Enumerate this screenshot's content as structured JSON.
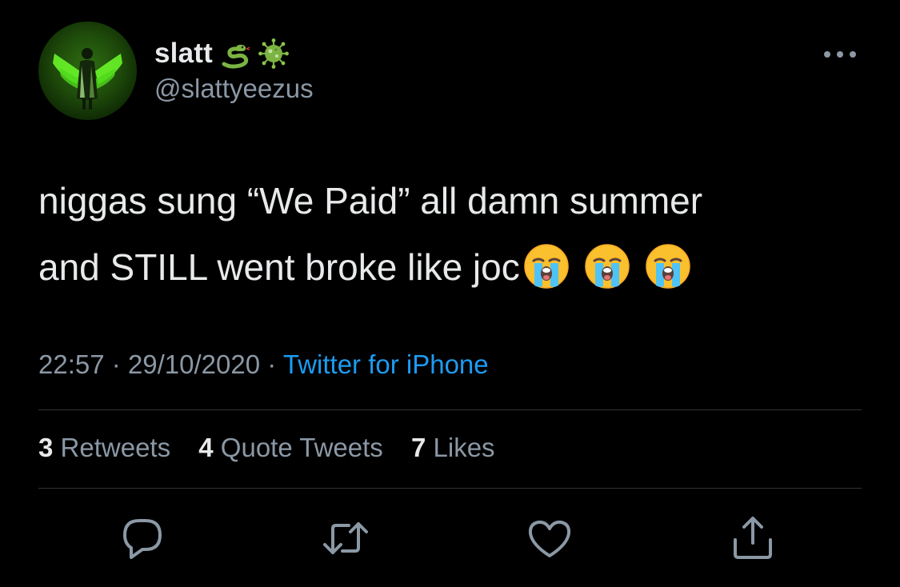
{
  "tweet": {
    "display_name": "slatt",
    "name_emojis": [
      "snake-emoji",
      "microbe-emoji"
    ],
    "handle": "@slattyeezus",
    "text_line1": "niggas sung “We Paid” all damn summer",
    "text_line2": "and STILL went broke like joc",
    "text_emojis": [
      "loudly-crying-face-emoji",
      "loudly-crying-face-emoji",
      "loudly-crying-face-emoji"
    ],
    "time": "22:57",
    "date": "29/10/2020",
    "separator": "·",
    "source": "Twitter for iPhone"
  },
  "stats": {
    "retweets_count": "3",
    "retweets_label": "Retweets",
    "quotes_count": "4",
    "quotes_label": "Quote Tweets",
    "likes_count": "7",
    "likes_label": "Likes"
  },
  "actions": [
    "reply-icon",
    "retweet-icon",
    "like-icon",
    "share-icon"
  ],
  "colors": {
    "background": "#000000",
    "text_primary": "#e7e9ea",
    "text_secondary": "#8b98a5",
    "link": "#1d9bf0",
    "divider": "#2f3336"
  }
}
